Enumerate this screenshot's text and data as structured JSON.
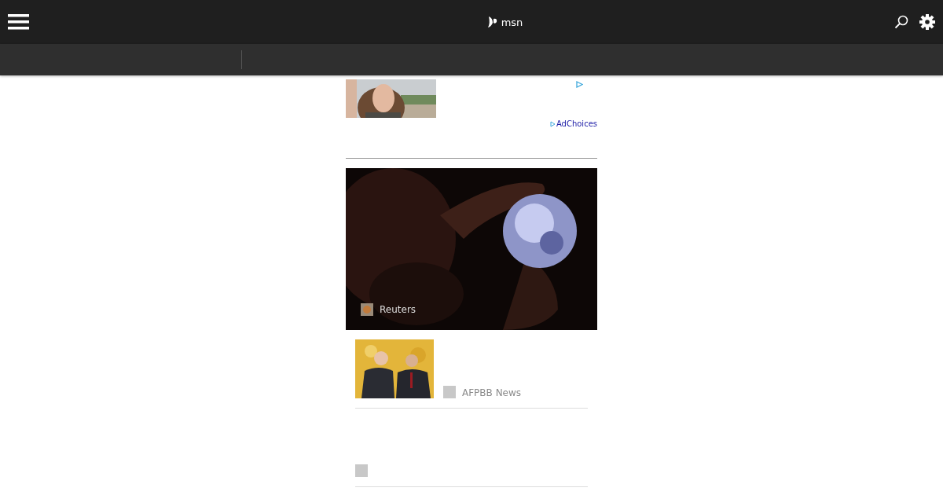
{
  "header": {
    "brand": "msn"
  },
  "ad": {
    "adchoices": "AdChoices"
  },
  "hero": {
    "source": "Reuters"
  },
  "stories": [
    {
      "kind": "thumb",
      "source": "AFPBB News"
    },
    {
      "kind": "plain"
    }
  ]
}
